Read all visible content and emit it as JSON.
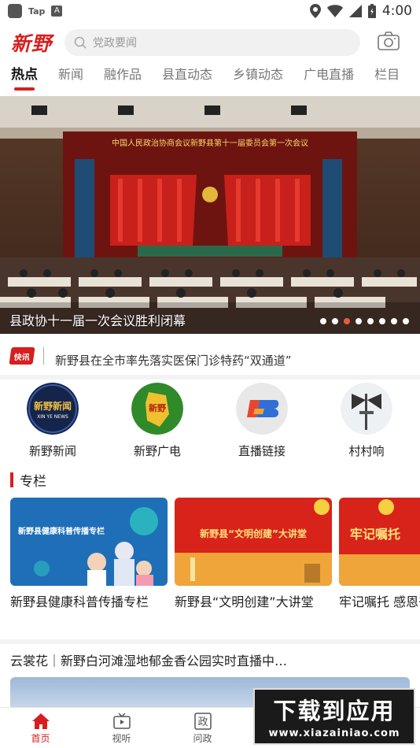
{
  "status_bar": {
    "app_label": "Tap",
    "time": "4:00"
  },
  "header": {
    "logo": "新野",
    "search_placeholder": "党政要闻"
  },
  "tabs": [
    {
      "label": "热点",
      "active": true
    },
    {
      "label": "新闻"
    },
    {
      "label": "融作品"
    },
    {
      "label": "县直动态"
    },
    {
      "label": "乡镇动态"
    },
    {
      "label": "广电直播"
    },
    {
      "label": "栏目"
    }
  ],
  "banner": {
    "stage_title": "中国人民政治协商会议新野县第十一届委员会第一次会议",
    "caption": "县政协十一届一次会议胜利闭幕",
    "slide_count": 8,
    "active_slide": 3
  },
  "flash_news": {
    "badge": "快讯",
    "text": "新野县在全市率先落实医保门诊特药“双通道”"
  },
  "quick_links": [
    {
      "label": "新野新闻",
      "icon": "xinye-news-icon",
      "icon_text": "新野新闻",
      "icon_sub": "XIN YE NEWS"
    },
    {
      "label": "新野广电",
      "icon": "xinye-tv-icon",
      "icon_text": "新野"
    },
    {
      "label": "直播链接",
      "icon": "live-link-icon"
    },
    {
      "label": "村村响",
      "icon": "village-speaker-icon"
    }
  ],
  "section": {
    "title": "专栏",
    "cards": [
      {
        "title": "新野县健康科普传播专栏",
        "image_text": "新野县健康科普传播专栏"
      },
      {
        "title": "新野县“文明创建”大讲堂",
        "image_text": "新野县“文明创建”大讲堂"
      },
      {
        "title": "牢记嘱托 感恩奋进",
        "image_text": "牢记嘱托"
      }
    ]
  },
  "live": {
    "title": "云裳花｜新野白河滩湿地郁金香公园实时直播中…"
  },
  "bottom_nav": [
    {
      "label": "首页",
      "icon": "home-icon",
      "active": true
    },
    {
      "label": "视听",
      "icon": "tv-icon"
    },
    {
      "label": "问政",
      "icon": "politics-icon",
      "icon_text": "政"
    }
  ],
  "watermark": {
    "main": "下载到应用",
    "sub": "www.xiazainiao.com"
  },
  "colors": {
    "brand_red": "#d71f1f",
    "active_dot": "#e85c3b"
  }
}
